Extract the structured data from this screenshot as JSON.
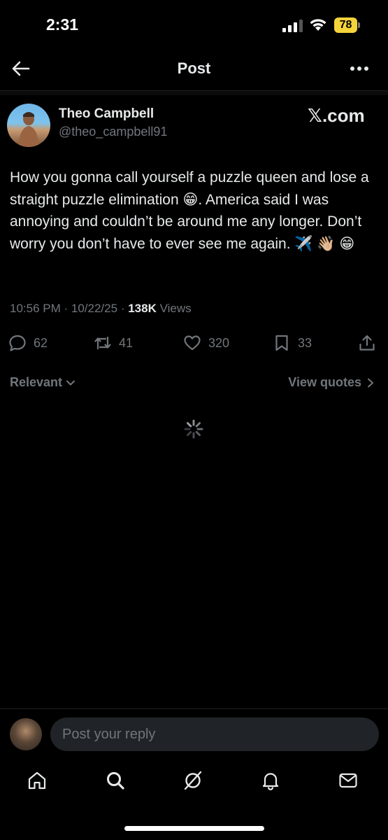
{
  "status_bar": {
    "time": "2:31",
    "battery": "78"
  },
  "header": {
    "title": "Post"
  },
  "post": {
    "author_name": "Theo Campbell",
    "author_handle": "@theo_campbell91",
    "source_badge": "𝕏.com",
    "text": "How you gonna call yourself a puzzle queen and lose a straight puzzle elimination 😁. America said I was annoying and couldn’t be around me any longer. Don’t worry you don’t have to ever see me again. ✈️ 👋🏼 😁",
    "time": "10:56 PM",
    "date": "10/22/25",
    "views_count": "138K",
    "views_label": "Views",
    "replies": "62",
    "reposts": "41",
    "likes": "320",
    "bookmarks": "33"
  },
  "sort": {
    "relevant_label": "Relevant",
    "view_quotes_label": "View quotes"
  },
  "reply": {
    "placeholder": "Post your reply"
  },
  "icons": {
    "back": "arrow-left-icon",
    "more": "more-horizontal-icon",
    "reply": "reply-icon",
    "repost": "repost-icon",
    "like": "heart-icon",
    "bookmark": "bookmark-icon",
    "share": "share-icon",
    "home": "home-icon",
    "search": "search-icon",
    "grok": "grok-icon",
    "notifications": "bell-icon",
    "messages": "mail-icon"
  },
  "colors": {
    "accent": "#1d9bf0",
    "battery": "#f5d33a",
    "muted": "#71767b"
  }
}
